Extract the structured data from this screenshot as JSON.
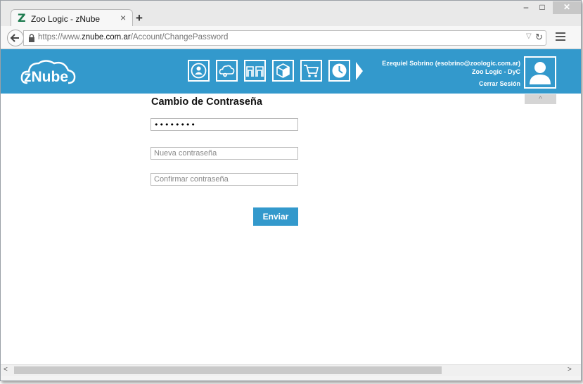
{
  "browser": {
    "tab_title": "Zoo Logic - zNube",
    "tab_close": "×",
    "new_tab": "+",
    "url_prefix": "https://www.",
    "url_host": "znube.com.ar",
    "url_path": "/Account/ChangePassword",
    "window_min": "–",
    "window_max": "□",
    "window_close": "✕",
    "reload": "↻",
    "dropdown": "▽"
  },
  "header": {
    "logo_text": "zNube",
    "nav_icons": [
      "users-icon",
      "cloud-settings-icon",
      "stores-icon",
      "box-icon",
      "cart-icon",
      "clock-icon"
    ],
    "user_name": "Ezequiel Sobrino (esobrino@zoologic.com.ar)",
    "organization": "Zoo Logic - DyC",
    "logout_label": "Cerrar Sesión",
    "collapse_label": "^",
    "accent_color": "#3399cc"
  },
  "form": {
    "title": "Cambio de Contraseña",
    "current_password_value": "••••••••",
    "new_password_placeholder": "Nueva contraseña",
    "confirm_password_placeholder": "Confirmar contraseña",
    "submit_label": "Enviar"
  },
  "scrollbar": {
    "left_arrow": "<",
    "right_arrow": ">"
  }
}
